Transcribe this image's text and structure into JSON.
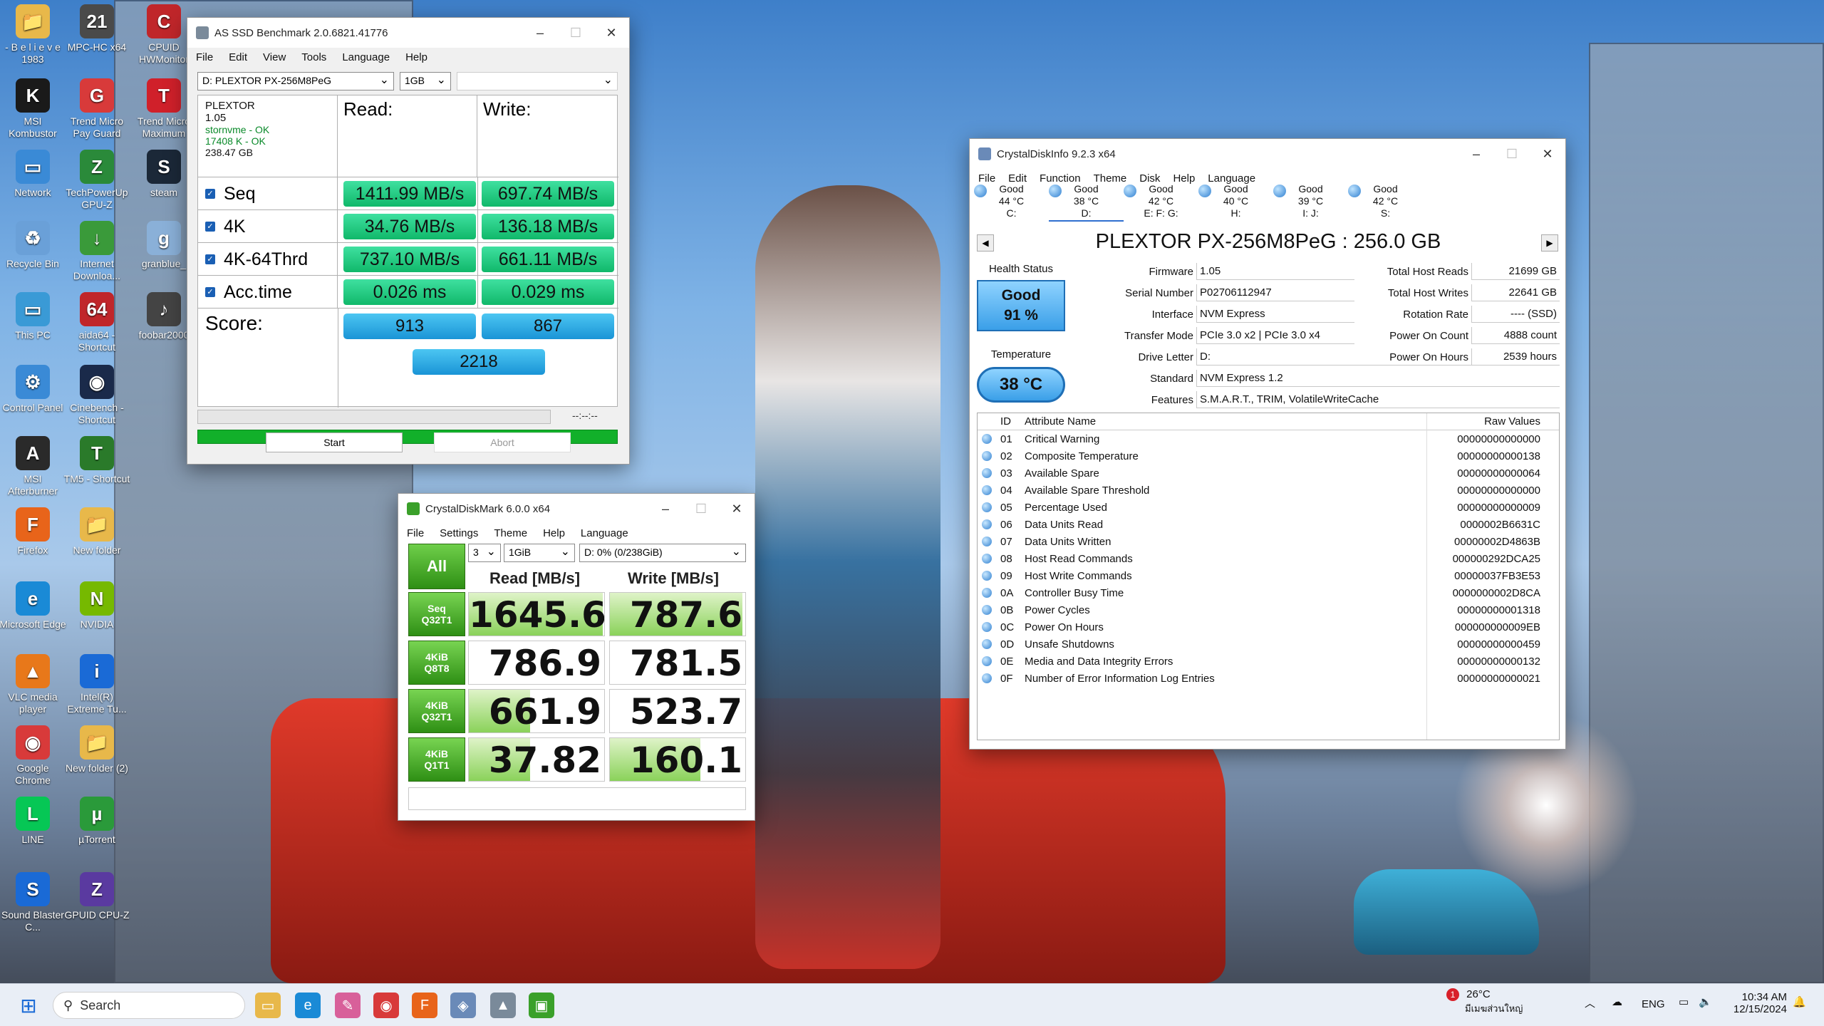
{
  "desktop": {
    "icons": [
      {
        "label": "- B e l i e v e 1983",
        "glyph": "📁",
        "color": "#e8b84a"
      },
      {
        "label": "MPC-HC x64",
        "glyph": "21",
        "color": "#4a4a4a"
      },
      {
        "label": "CPUID HWMonitor",
        "glyph": "C",
        "color": "#c0262a"
      },
      {
        "label": "MSI Kombustor",
        "glyph": "K",
        "color": "#1a1a1a"
      },
      {
        "label": "Trend Micro Pay Guard",
        "glyph": "G",
        "color": "#d83a3a"
      },
      {
        "label": "Trend Micro Maximum",
        "glyph": "T",
        "color": "#d0202a"
      },
      {
        "label": "Network",
        "glyph": "▭",
        "color": "#3a8ad6"
      },
      {
        "label": "TechPowerUp GPU-Z",
        "glyph": "Z",
        "color": "#2a8a3a"
      },
      {
        "label": "steam",
        "glyph": "S",
        "color": "#1b2838"
      },
      {
        "label": "Recycle Bin",
        "glyph": "♻",
        "color": "#6aa0d8"
      },
      {
        "label": "Internet Downloa...",
        "glyph": "↓",
        "color": "#3a9a3a"
      },
      {
        "label": "granblue_",
        "glyph": "g",
        "color": "#8ab0d8"
      },
      {
        "label": "This PC",
        "glyph": "▭",
        "color": "#3a9ad6"
      },
      {
        "label": "aida64 - Shortcut",
        "glyph": "64",
        "color": "#c0262a"
      },
      {
        "label": "foobar2000",
        "glyph": "♪",
        "color": "#444444"
      },
      {
        "label": "Control Panel",
        "glyph": "⚙",
        "color": "#3a8ad6"
      },
      {
        "label": "Cinebench - Shortcut",
        "glyph": "◉",
        "color": "#1a2a4a"
      },
      {
        "label": "MSI Afterburner",
        "glyph": "A",
        "color": "#2a2a2a"
      },
      {
        "label": "TM5 - Shortcut",
        "glyph": "T",
        "color": "#2a7a2a"
      },
      {
        "label": "Firefox",
        "glyph": "F",
        "color": "#e8641a"
      },
      {
        "label": "New folder",
        "glyph": "📁",
        "color": "#e8b84a"
      },
      {
        "label": "Microsoft Edge",
        "glyph": "e",
        "color": "#1a8ad6"
      },
      {
        "label": "NVIDIA",
        "glyph": "N",
        "color": "#76b900"
      },
      {
        "label": "VLC media player",
        "glyph": "▲",
        "color": "#e8781a"
      },
      {
        "label": "Intel(R) Extreme Tu...",
        "glyph": "i",
        "color": "#1a6ad6"
      },
      {
        "label": "Google Chrome",
        "glyph": "◉",
        "color": "#d83a3a"
      },
      {
        "label": "New folder (2)",
        "glyph": "📁",
        "color": "#e8b84a"
      },
      {
        "label": "LINE",
        "glyph": "L",
        "color": "#06c755"
      },
      {
        "label": "µTorrent",
        "glyph": "µ",
        "color": "#2a9a3a"
      },
      {
        "label": "Sound Blaster C...",
        "glyph": "S",
        "color": "#1a6ad6"
      },
      {
        "label": "GPUID CPU-Z",
        "glyph": "Z",
        "color": "#5a3aa0"
      }
    ]
  },
  "asssd": {
    "title": "AS SSD Benchmark 2.0.6821.41776",
    "menu": [
      "File",
      "Edit",
      "View",
      "Tools",
      "Language",
      "Help"
    ],
    "drive_select": "D: PLEXTOR PX-256M8PeG",
    "size_select": "1GB",
    "info": {
      "model": "PLEXTOR",
      "fw": "1.05",
      "driver": "stornvme - OK",
      "align": "17408 K - OK",
      "capacity": "238.47 GB"
    },
    "read_label": "Read:",
    "write_label": "Write:",
    "rows": [
      {
        "label": "Seq",
        "read": "1411.99 MB/s",
        "write": "697.74 MB/s"
      },
      {
        "label": "4K",
        "read": "34.76 MB/s",
        "write": "136.18 MB/s"
      },
      {
        "label": "4K-64Thrd",
        "read": "737.10 MB/s",
        "write": "661.11 MB/s"
      },
      {
        "label": "Acc.time",
        "read": "0.026 ms",
        "write": "0.029 ms"
      }
    ],
    "score_label": "Score:",
    "score_read": "913",
    "score_write": "867",
    "score_total": "2218",
    "time": "--:--:--",
    "start_label": "Start",
    "abort_label": "Abort"
  },
  "cdm": {
    "title": "CrystalDiskMark 6.0.0 x64",
    "menu": [
      "File",
      "Settings",
      "Theme",
      "Help",
      "Language"
    ],
    "all_label": "All",
    "count": "3",
    "size": "1GiB",
    "drive": "D: 0% (0/238GiB)",
    "read_header": "Read [MB/s]",
    "write_header": "Write [MB/s]",
    "rows": [
      {
        "l1": "Seq",
        "l2": "Q32T1",
        "read": "1645.6",
        "write": "787.6",
        "read_fill": 0.99,
        "write_fill": 0.98
      },
      {
        "l1": "4KiB",
        "l2": "Q8T8",
        "read": "786.9",
        "write": "781.5",
        "read_fill": 0.0,
        "write_fill": 0.0
      },
      {
        "l1": "4KiB",
        "l2": "Q32T1",
        "read": "661.9",
        "write": "523.7",
        "read_fill": 0.45,
        "write_fill": 0.0
      },
      {
        "l1": "4KiB",
        "l2": "Q1T1",
        "read": "37.82",
        "write": "160.1",
        "read_fill": 0.45,
        "write_fill": 0.67
      }
    ]
  },
  "cdi": {
    "title": "CrystalDiskInfo 9.2.3 x64",
    "menu": [
      "File",
      "Edit",
      "Function",
      "Theme",
      "Disk",
      "Help",
      "Language"
    ],
    "drives": [
      {
        "status": "Good",
        "temp": "44 °C",
        "letter": "C:"
      },
      {
        "status": "Good",
        "temp": "38 °C",
        "letter": "D:"
      },
      {
        "status": "Good",
        "temp": "42 °C",
        "letter": "E: F: G:"
      },
      {
        "status": "Good",
        "temp": "40 °C",
        "letter": "H:"
      },
      {
        "status": "Good",
        "temp": "39 °C",
        "letter": "I: J:"
      },
      {
        "status": "Good",
        "temp": "42 °C",
        "letter": "S:"
      }
    ],
    "heading": "PLEXTOR PX-256M8PeG : 256.0 GB",
    "health_label": "Health Status",
    "health_status": "Good",
    "health_pct": "91 %",
    "temp_label": "Temperature",
    "temp_value": "38 °C",
    "fields": {
      "firmware_label": "Firmware",
      "firmware": "1.05",
      "serial_label": "Serial Number",
      "serial": "P02706112947",
      "interface_label": "Interface",
      "interface": "NVM Express",
      "transfer_label": "Transfer Mode",
      "transfer": "PCIe 3.0 x2 | PCIe 3.0 x4",
      "letter_label": "Drive Letter",
      "letter": "D:",
      "standard_label": "Standard",
      "standard": "NVM Express 1.2",
      "features_label": "Features",
      "features": "S.M.A.R.T., TRIM, VolatileWriteCache",
      "reads_label": "Total Host Reads",
      "reads": "21699 GB",
      "writes_label": "Total Host Writes",
      "writes": "22641 GB",
      "rotation_label": "Rotation Rate",
      "rotation": "---- (SSD)",
      "poc_label": "Power On Count",
      "poc": "4888 count",
      "poh_label": "Power On Hours",
      "poh": "2539 hours"
    },
    "attr_headers": {
      "id": "ID",
      "name": "Attribute Name",
      "raw": "Raw Values"
    },
    "attributes": [
      {
        "id": "01",
        "name": "Critical Warning",
        "raw": "00000000000000"
      },
      {
        "id": "02",
        "name": "Composite Temperature",
        "raw": "00000000000138"
      },
      {
        "id": "03",
        "name": "Available Spare",
        "raw": "00000000000064"
      },
      {
        "id": "04",
        "name": "Available Spare Threshold",
        "raw": "00000000000000"
      },
      {
        "id": "05",
        "name": "Percentage Used",
        "raw": "00000000000009"
      },
      {
        "id": "06",
        "name": "Data Units Read",
        "raw": "0000002B6631C"
      },
      {
        "id": "07",
        "name": "Data Units Written",
        "raw": "00000002D4863B"
      },
      {
        "id": "08",
        "name": "Host Read Commands",
        "raw": "000000292DCA25"
      },
      {
        "id": "09",
        "name": "Host Write Commands",
        "raw": "00000037FB3E53"
      },
      {
        "id": "0A",
        "name": "Controller Busy Time",
        "raw": "0000000002D8CA"
      },
      {
        "id": "0B",
        "name": "Power Cycles",
        "raw": "00000000001318"
      },
      {
        "id": "0C",
        "name": "Power On Hours",
        "raw": "000000000009EB"
      },
      {
        "id": "0D",
        "name": "Unsafe Shutdowns",
        "raw": "00000000000459"
      },
      {
        "id": "0E",
        "name": "Media and Data Integrity Errors",
        "raw": "00000000000132"
      },
      {
        "id": "0F",
        "name": "Number of Error Information Log Entries",
        "raw": "00000000000021"
      }
    ]
  },
  "taskbar": {
    "search_placeholder": "Search",
    "weather_temp": "26°C",
    "weather_desc": "มีเมฆส่วนใหญ่",
    "weather_badge": "1",
    "lang": "ENG",
    "time": "10:34 AM",
    "date": "12/15/2024"
  }
}
